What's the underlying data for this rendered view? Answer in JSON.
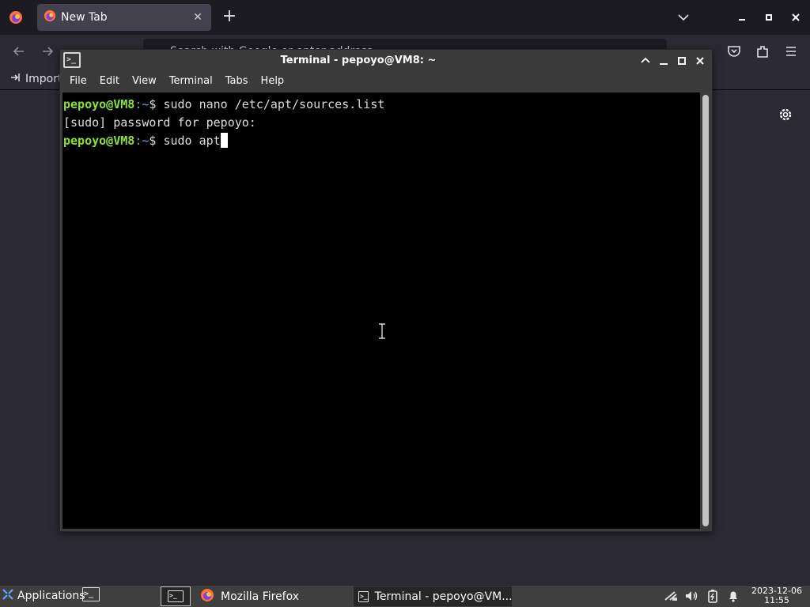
{
  "firefox": {
    "tab_title": "New Tab",
    "tab_close": "✕",
    "new_tab": "+",
    "url_placeholder": "Search with Google or enter address",
    "bookmark_import": "Import"
  },
  "terminal": {
    "title": "Terminal - pepoyo@VM8: ~",
    "menu": [
      "File",
      "Edit",
      "View",
      "Terminal",
      "Tabs",
      "Help"
    ],
    "lines": [
      {
        "user": "pepoyo@VM8",
        "path": ":~",
        "prompt": "$ ",
        "command": "sudo nano /etc/apt/sources.list"
      },
      {
        "text": "[sudo] password for pepoyo:"
      },
      {
        "user": "pepoyo@VM8",
        "path": ":~",
        "prompt": "$ ",
        "command": "sudo apt"
      }
    ]
  },
  "panel": {
    "applications_label": "Applications",
    "tasks": [
      "Mozilla Firefox",
      "Terminal - pepoyo@VM..."
    ],
    "clock_date": "2023-12-06",
    "clock_time": "11:55"
  }
}
